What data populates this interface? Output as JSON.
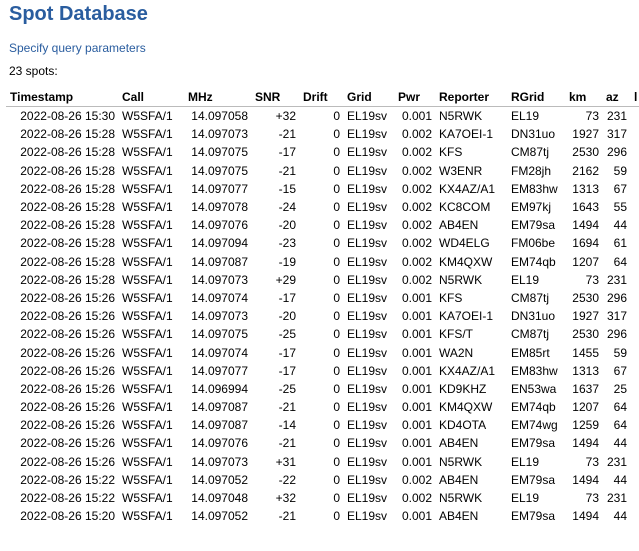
{
  "page_title": "Spot Database",
  "query_link": "Specify query parameters",
  "spot_count": "23 spots:",
  "columns": [
    "Timestamp",
    "Call",
    "MHz",
    "SNR",
    "Drift",
    "Grid",
    "Pwr",
    "Reporter",
    "RGrid",
    "km",
    "az",
    "l"
  ],
  "rows": [
    [
      "2022-08-26 15:30",
      "W5SFA/1",
      "14.097058",
      "+32",
      "0",
      "EL19sv",
      "0.001",
      "N5RWK",
      "EL19",
      "73",
      "231"
    ],
    [
      "2022-08-26 15:28",
      "W5SFA/1",
      "14.097073",
      "-21",
      "0",
      "EL19sv",
      "0.002",
      "KA7OEI-1",
      "DN31uo",
      "1927",
      "317"
    ],
    [
      "2022-08-26 15:28",
      "W5SFA/1",
      "14.097075",
      "-17",
      "0",
      "EL19sv",
      "0.002",
      "KFS",
      "CM87tj",
      "2530",
      "296"
    ],
    [
      "2022-08-26 15:28",
      "W5SFA/1",
      "14.097075",
      "-21",
      "0",
      "EL19sv",
      "0.002",
      "W3ENR",
      "FM28jh",
      "2162",
      "59"
    ],
    [
      "2022-08-26 15:28",
      "W5SFA/1",
      "14.097077",
      "-15",
      "0",
      "EL19sv",
      "0.002",
      "KX4AZ/A1",
      "EM83hw",
      "1313",
      "67"
    ],
    [
      "2022-08-26 15:28",
      "W5SFA/1",
      "14.097078",
      "-24",
      "0",
      "EL19sv",
      "0.002",
      "KC8COM",
      "EM97kj",
      "1643",
      "55"
    ],
    [
      "2022-08-26 15:28",
      "W5SFA/1",
      "14.097076",
      "-20",
      "0",
      "EL19sv",
      "0.002",
      "AB4EN",
      "EM79sa",
      "1494",
      "44"
    ],
    [
      "2022-08-26 15:28",
      "W5SFA/1",
      "14.097094",
      "-23",
      "0",
      "EL19sv",
      "0.002",
      "WD4ELG",
      "FM06be",
      "1694",
      "61"
    ],
    [
      "2022-08-26 15:28",
      "W5SFA/1",
      "14.097087",
      "-19",
      "0",
      "EL19sv",
      "0.002",
      "KM4QXW",
      "EM74qb",
      "1207",
      "64"
    ],
    [
      "2022-08-26 15:28",
      "W5SFA/1",
      "14.097073",
      "+29",
      "0",
      "EL19sv",
      "0.002",
      "N5RWK",
      "EL19",
      "73",
      "231"
    ],
    [
      "2022-08-26 15:26",
      "W5SFA/1",
      "14.097074",
      "-17",
      "0",
      "EL19sv",
      "0.001",
      "KFS",
      "CM87tj",
      "2530",
      "296"
    ],
    [
      "2022-08-26 15:26",
      "W5SFA/1",
      "14.097073",
      "-20",
      "0",
      "EL19sv",
      "0.001",
      "KA7OEI-1",
      "DN31uo",
      "1927",
      "317"
    ],
    [
      "2022-08-26 15:26",
      "W5SFA/1",
      "14.097075",
      "-25",
      "0",
      "EL19sv",
      "0.001",
      "KFS/T",
      "CM87tj",
      "2530",
      "296"
    ],
    [
      "2022-08-26 15:26",
      "W5SFA/1",
      "14.097074",
      "-17",
      "0",
      "EL19sv",
      "0.001",
      "WA2N",
      "EM85rt",
      "1455",
      "59"
    ],
    [
      "2022-08-26 15:26",
      "W5SFA/1",
      "14.097077",
      "-17",
      "0",
      "EL19sv",
      "0.001",
      "KX4AZ/A1",
      "EM83hw",
      "1313",
      "67"
    ],
    [
      "2022-08-26 15:26",
      "W5SFA/1",
      "14.096994",
      "-25",
      "0",
      "EL19sv",
      "0.001",
      "KD9KHZ",
      "EN53wa",
      "1637",
      "25"
    ],
    [
      "2022-08-26 15:26",
      "W5SFA/1",
      "14.097087",
      "-21",
      "0",
      "EL19sv",
      "0.001",
      "KM4QXW",
      "EM74qb",
      "1207",
      "64"
    ],
    [
      "2022-08-26 15:26",
      "W5SFA/1",
      "14.097087",
      "-14",
      "0",
      "EL19sv",
      "0.001",
      "KD4OTA",
      "EM74wg",
      "1259",
      "64"
    ],
    [
      "2022-08-26 15:26",
      "W5SFA/1",
      "14.097076",
      "-21",
      "0",
      "EL19sv",
      "0.001",
      "AB4EN",
      "EM79sa",
      "1494",
      "44"
    ],
    [
      "2022-08-26 15:26",
      "W5SFA/1",
      "14.097073",
      "+31",
      "0",
      "EL19sv",
      "0.001",
      "N5RWK",
      "EL19",
      "73",
      "231"
    ],
    [
      "2022-08-26 15:22",
      "W5SFA/1",
      "14.097052",
      "-22",
      "0",
      "EL19sv",
      "0.002",
      "AB4EN",
      "EM79sa",
      "1494",
      "44"
    ],
    [
      "2022-08-26 15:22",
      "W5SFA/1",
      "14.097048",
      "+32",
      "0",
      "EL19sv",
      "0.002",
      "N5RWK",
      "EL19",
      "73",
      "231"
    ],
    [
      "2022-08-26 15:20",
      "W5SFA/1",
      "14.097052",
      "-21",
      "0",
      "EL19sv",
      "0.001",
      "AB4EN",
      "EM79sa",
      "1494",
      "44"
    ]
  ]
}
